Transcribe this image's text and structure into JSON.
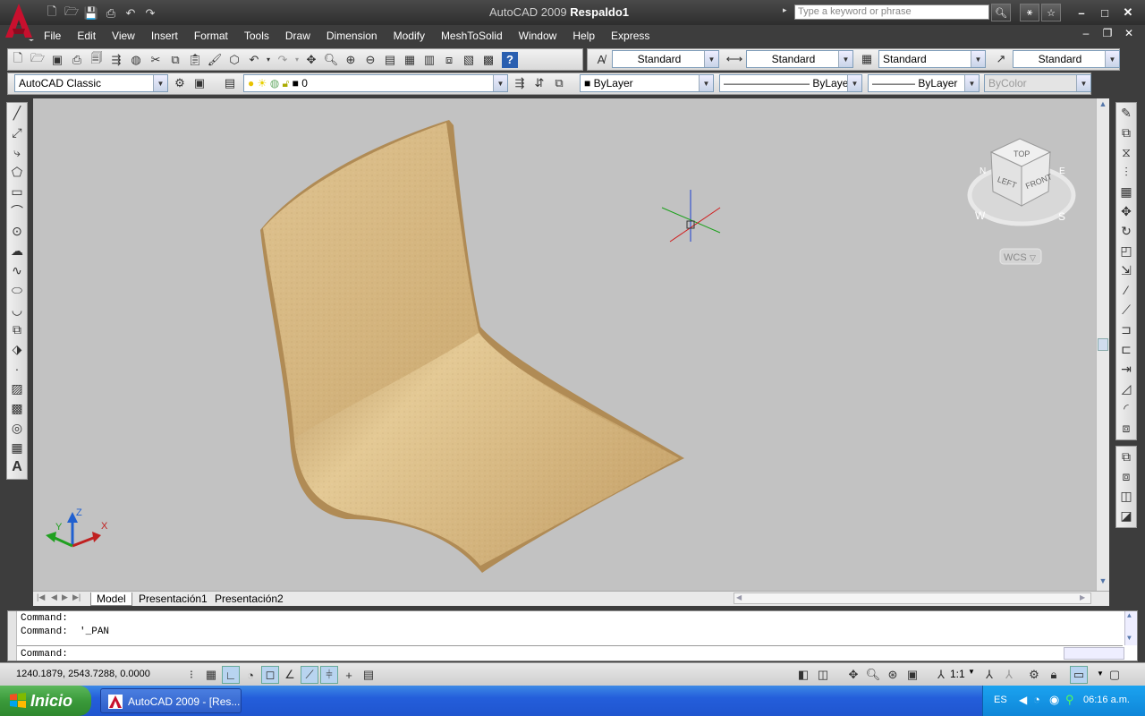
{
  "titlebar": {
    "app_name": "AutoCAD 2009",
    "doc_name": "Respaldo1",
    "search_placeholder": "Type a keyword or phrase"
  },
  "menu": [
    "File",
    "Edit",
    "View",
    "Insert",
    "Format",
    "Tools",
    "Draw",
    "Dimension",
    "Modify",
    "MeshToSolid",
    "Window",
    "Help",
    "Express"
  ],
  "styles_toolbar": {
    "text_style": "Standard",
    "dim_style": "Standard",
    "table_style": "Standard",
    "multileader_style": "Standard"
  },
  "workspace": "AutoCAD Classic",
  "layer": "0",
  "properties": {
    "color": "ByLayer",
    "linetype": "ByLayer",
    "lineweight": "ByLayer",
    "plotstyle": "ByColor"
  },
  "viewcube": {
    "top": "TOP",
    "left": "LEFT",
    "front": "FRONT",
    "compass_n": "N",
    "compass_w": "W",
    "compass_s": "S",
    "compass_e": "E",
    "ucs_label": "WCS"
  },
  "ucs_icon": {
    "x": "X",
    "y": "Y",
    "z": "Z"
  },
  "tabs": [
    "Model",
    "Presentación1",
    "Presentación2"
  ],
  "command": {
    "line1": "Command:",
    "line2": "Command:  '_PAN",
    "prompt": "Command:"
  },
  "status": {
    "coordinates": "1240.1879, 2543.7288, 0.0000",
    "annotation_scale": "1:1"
  },
  "taskbar": {
    "start_label": "Inicio",
    "task_label": "AutoCAD 2009 - [Res...",
    "language": "ES",
    "clock": "06:16 a.m."
  },
  "colors": {
    "chair": "#d2b07a",
    "viewport_bg": "#c2c2c2",
    "title_bg": "#3a3a3a",
    "taskbar": "#245edb",
    "start": "#3a9a3a"
  }
}
